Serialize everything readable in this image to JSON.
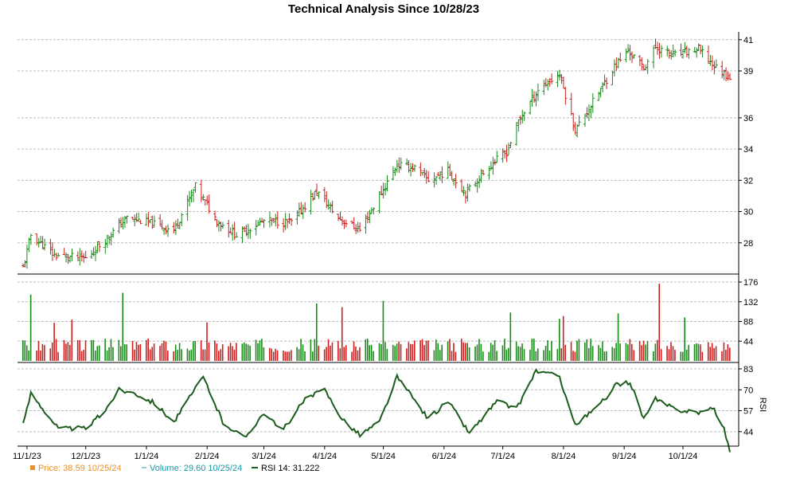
{
  "chart_data": [
    {
      "type": "candlestick",
      "panel": "price",
      "title": "Technical Analysis Since 10/28/23",
      "ylim": [
        26.0,
        41.5
      ],
      "yticks": [
        28,
        30,
        32,
        34,
        36,
        39,
        41
      ],
      "grid": true,
      "colors": {
        "up": "#1a8a1a",
        "down": "#cc1f1f"
      },
      "date_range": [
        "2023-10-30",
        "2024-10-25"
      ],
      "last_close": 38.59,
      "anchor_closes": [
        {
          "date": "2023-10-30",
          "close": 26.4
        },
        {
          "date": "2023-11-03",
          "close": 28.5
        },
        {
          "date": "2023-11-15",
          "close": 27.2
        },
        {
          "date": "2023-12-01",
          "close": 27.0
        },
        {
          "date": "2023-12-15",
          "close": 28.7
        },
        {
          "date": "2023-12-22",
          "close": 29.6
        },
        {
          "date": "2024-01-05",
          "close": 29.2
        },
        {
          "date": "2024-01-15",
          "close": 28.8
        },
        {
          "date": "2024-01-26",
          "close": 31.6
        },
        {
          "date": "2024-02-06",
          "close": 29.4
        },
        {
          "date": "2024-02-16",
          "close": 28.5
        },
        {
          "date": "2024-03-01",
          "close": 29.4
        },
        {
          "date": "2024-03-15",
          "close": 29.3
        },
        {
          "date": "2024-03-28",
          "close": 31.3
        },
        {
          "date": "2024-04-08",
          "close": 29.6
        },
        {
          "date": "2024-04-19",
          "close": 28.8
        },
        {
          "date": "2024-04-30",
          "close": 31.2
        },
        {
          "date": "2024-05-08",
          "close": 33.0
        },
        {
          "date": "2024-05-17",
          "close": 32.8
        },
        {
          "date": "2024-05-24",
          "close": 32.0
        },
        {
          "date": "2024-06-03",
          "close": 32.6
        },
        {
          "date": "2024-06-12",
          "close": 31.2
        },
        {
          "date": "2024-06-25",
          "close": 33.0
        },
        {
          "date": "2024-07-03",
          "close": 33.8
        },
        {
          "date": "2024-07-09",
          "close": 35.8
        },
        {
          "date": "2024-07-19",
          "close": 37.8
        },
        {
          "date": "2024-07-30",
          "close": 38.8
        },
        {
          "date": "2024-08-07",
          "close": 35.2
        },
        {
          "date": "2024-08-16",
          "close": 37.0
        },
        {
          "date": "2024-08-27",
          "close": 39.3
        },
        {
          "date": "2024-09-03",
          "close": 40.3
        },
        {
          "date": "2024-09-11",
          "close": 39.2
        },
        {
          "date": "2024-09-17",
          "close": 40.5
        },
        {
          "date": "2024-09-27",
          "close": 40.0
        },
        {
          "date": "2024-10-09",
          "close": 40.4
        },
        {
          "date": "2024-10-17",
          "close": 39.3
        },
        {
          "date": "2024-10-25",
          "close": 38.59
        }
      ]
    },
    {
      "type": "bar",
      "panel": "volume",
      "ylim": [
        0,
        176
      ],
      "yticks": [
        44,
        88,
        132,
        176
      ],
      "grid": true,
      "tick_color": "#1a9aa8",
      "last_value": 29.6,
      "typical_range": [
        20,
        50
      ],
      "spikes": [
        {
          "date": "2023-11-03",
          "value": 148
        },
        {
          "date": "2023-11-15",
          "value": 85
        },
        {
          "date": "2023-11-24",
          "value": 92
        },
        {
          "date": "2023-12-20",
          "value": 152
        },
        {
          "date": "2024-02-01",
          "value": 86
        },
        {
          "date": "2024-03-28",
          "value": 128
        },
        {
          "date": "2024-04-10",
          "value": 120
        },
        {
          "date": "2024-05-01",
          "value": 134
        },
        {
          "date": "2024-07-05",
          "value": 108
        },
        {
          "date": "2024-07-30",
          "value": 94
        },
        {
          "date": "2024-08-01",
          "value": 100
        },
        {
          "date": "2024-08-29",
          "value": 106
        },
        {
          "date": "2024-09-19",
          "value": 172
        },
        {
          "date": "2024-10-02",
          "value": 97
        }
      ]
    },
    {
      "type": "line",
      "panel": "rsi",
      "ylim": [
        35,
        83
      ],
      "yticks": [
        44,
        57,
        70,
        83
      ],
      "ylabel": "RSI",
      "grid": true,
      "color": "#1c5c1c",
      "last_value": 31.222,
      "anchors": [
        {
          "date": "2023-10-30",
          "value": 48
        },
        {
          "date": "2023-11-03",
          "value": 68
        },
        {
          "date": "2023-11-10",
          "value": 57
        },
        {
          "date": "2023-11-17",
          "value": 46
        },
        {
          "date": "2023-12-01",
          "value": 46
        },
        {
          "date": "2023-12-10",
          "value": 56
        },
        {
          "date": "2023-12-18",
          "value": 70
        },
        {
          "date": "2023-12-26",
          "value": 68
        },
        {
          "date": "2024-01-05",
          "value": 62
        },
        {
          "date": "2024-01-15",
          "value": 50
        },
        {
          "date": "2024-01-30",
          "value": 78
        },
        {
          "date": "2024-02-09",
          "value": 50
        },
        {
          "date": "2024-02-20",
          "value": 40
        },
        {
          "date": "2024-03-01",
          "value": 56
        },
        {
          "date": "2024-03-10",
          "value": 44
        },
        {
          "date": "2024-03-22",
          "value": 64
        },
        {
          "date": "2024-04-01",
          "value": 70
        },
        {
          "date": "2024-04-10",
          "value": 52
        },
        {
          "date": "2024-04-19",
          "value": 42
        },
        {
          "date": "2024-04-29",
          "value": 50
        },
        {
          "date": "2024-05-08",
          "value": 78
        },
        {
          "date": "2024-05-24",
          "value": 52
        },
        {
          "date": "2024-06-03",
          "value": 63
        },
        {
          "date": "2024-06-14",
          "value": 43
        },
        {
          "date": "2024-06-28",
          "value": 63
        },
        {
          "date": "2024-07-08",
          "value": 58
        },
        {
          "date": "2024-07-18",
          "value": 82
        },
        {
          "date": "2024-07-30",
          "value": 78
        },
        {
          "date": "2024-08-07",
          "value": 48
        },
        {
          "date": "2024-08-19",
          "value": 60
        },
        {
          "date": "2024-08-28",
          "value": 73
        },
        {
          "date": "2024-09-04",
          "value": 75
        },
        {
          "date": "2024-09-11",
          "value": 52
        },
        {
          "date": "2024-09-17",
          "value": 64
        },
        {
          "date": "2024-09-27",
          "value": 58
        },
        {
          "date": "2024-10-09",
          "value": 56
        },
        {
          "date": "2024-10-17",
          "value": 58
        },
        {
          "date": "2024-10-22",
          "value": 46
        },
        {
          "date": "2024-10-25",
          "value": 31.222
        }
      ]
    }
  ],
  "x_axis": {
    "ticks": [
      {
        "date": "2023-11-01",
        "label": "11/1/23"
      },
      {
        "date": "2023-12-01",
        "label": "12/1/23"
      },
      {
        "date": "2024-01-01",
        "label": "1/1/24"
      },
      {
        "date": "2024-02-01",
        "label": "2/1/24"
      },
      {
        "date": "2024-03-01",
        "label": "3/1/24"
      },
      {
        "date": "2024-04-01",
        "label": "4/1/24"
      },
      {
        "date": "2024-05-01",
        "label": "5/1/24"
      },
      {
        "date": "2024-06-01",
        "label": "6/1/24"
      },
      {
        "date": "2024-07-01",
        "label": "7/1/24"
      },
      {
        "date": "2024-08-01",
        "label": "8/1/24"
      },
      {
        "date": "2024-09-01",
        "label": "9/1/24"
      },
      {
        "date": "2024-10-01",
        "label": "10/1/24"
      }
    ]
  },
  "legend": [
    {
      "text": "Price: 38.59  10/25/24",
      "color": "#e8922a",
      "marker": "square"
    },
    {
      "text": "Volume: 29.60  10/25/24",
      "color": "#1a9aa8",
      "marker": "dash"
    },
    {
      "text": "RSI 14: 31.222",
      "color": "#000000",
      "marker": "line",
      "marker_color": "#1c5c1c"
    }
  ]
}
